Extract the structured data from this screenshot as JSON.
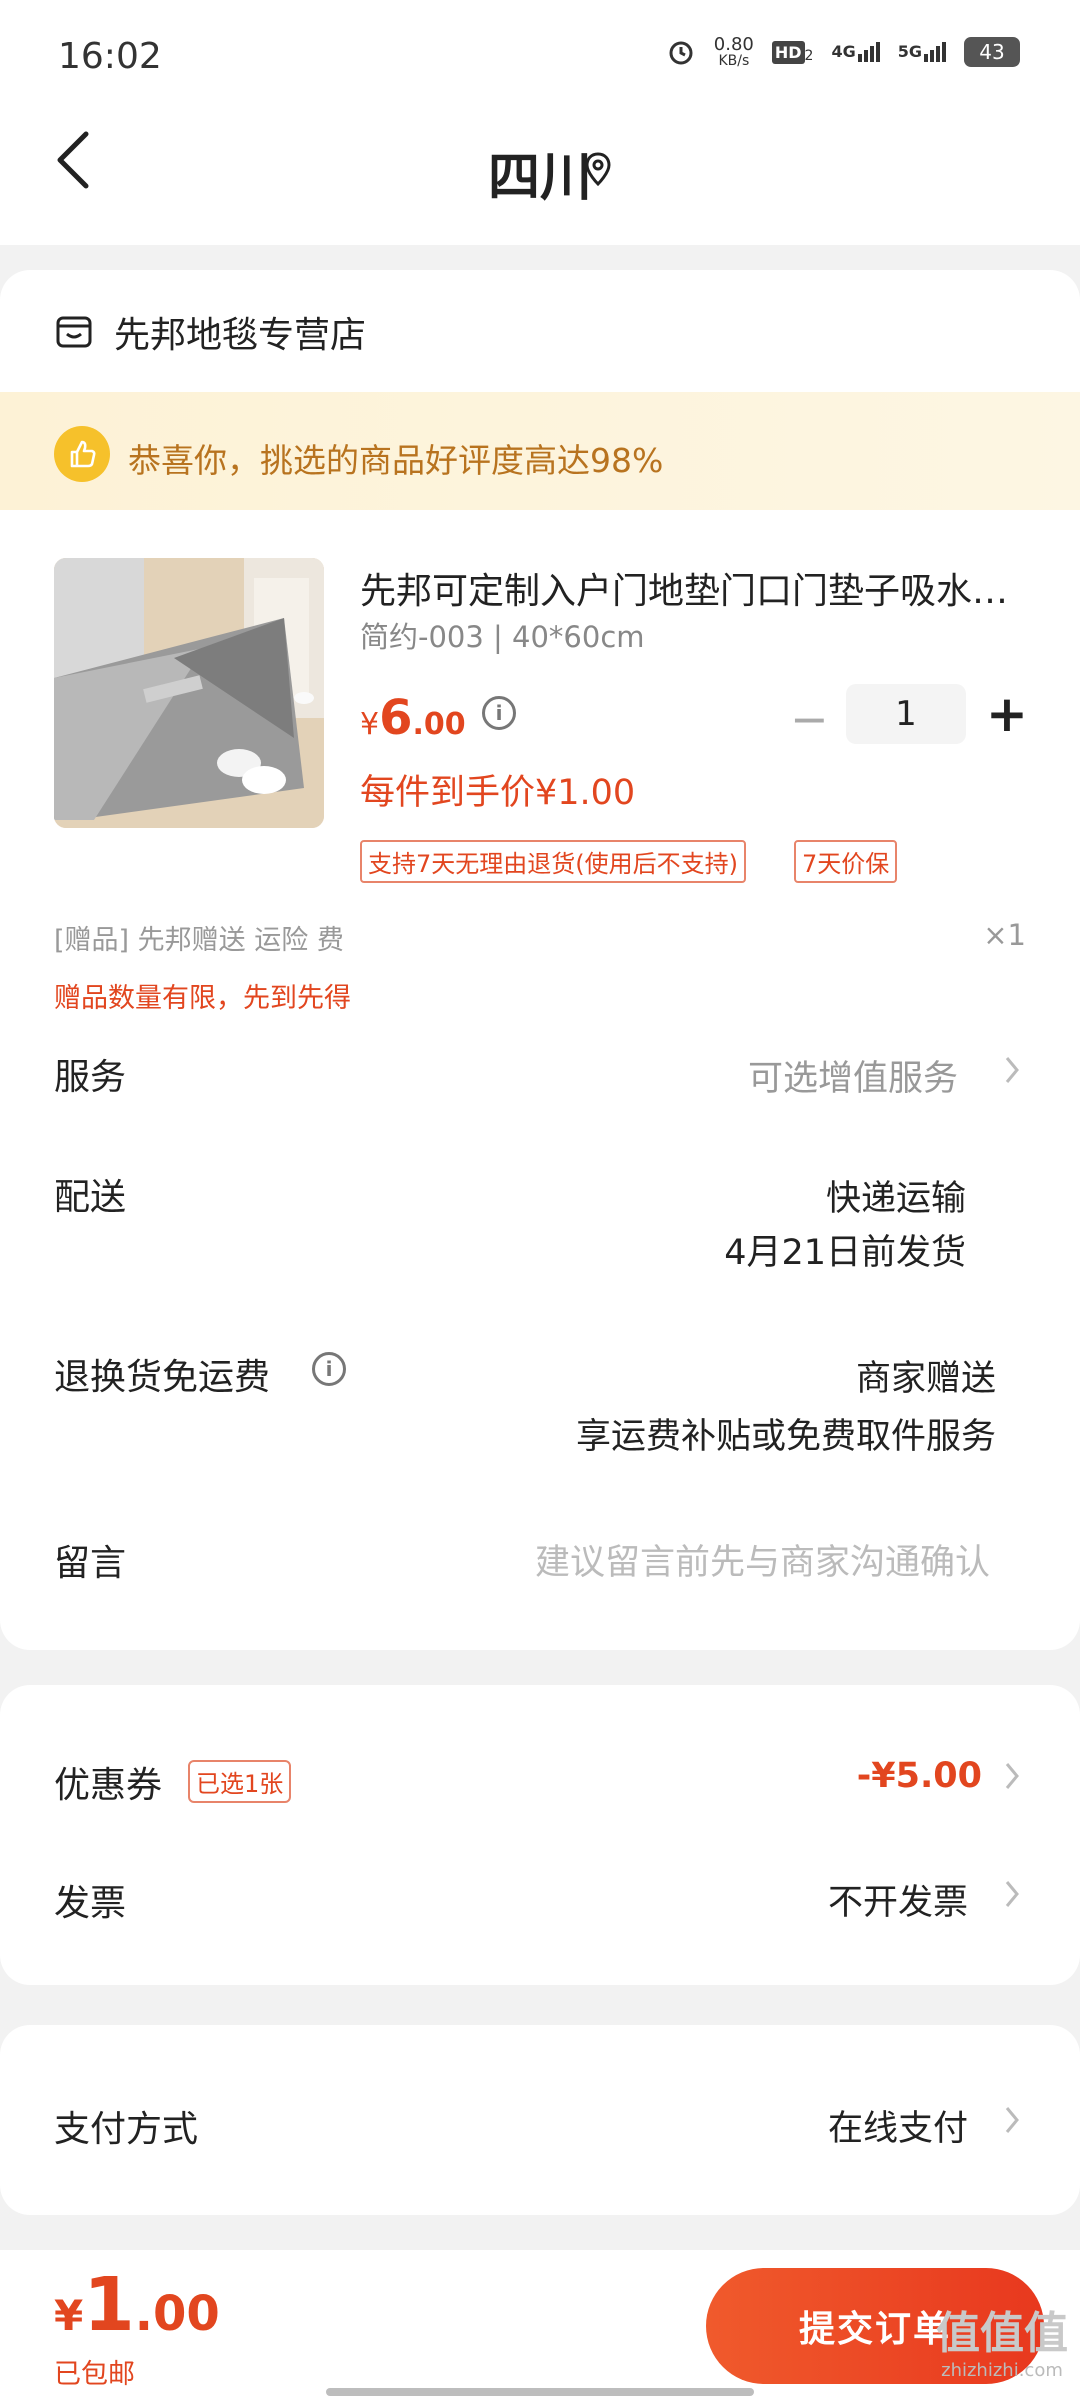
{
  "status_bar": {
    "time": "16:02",
    "net_speed_value": "0.80",
    "net_speed_unit": "KB/s",
    "hd_label": "HD",
    "hd_sub": "2",
    "sig1_label": "4G",
    "sig2_label": "5G",
    "battery": "43"
  },
  "header": {
    "title": "四川"
  },
  "store": {
    "name": "先邦地毯专营店"
  },
  "banner": {
    "text": "恭喜你，挑选的商品好评度高达98%"
  },
  "product": {
    "title": "先邦可定制入户门地垫门口门垫子吸水地毯",
    "spec": "简约-003 | 40*60cm",
    "price_currency": "¥",
    "price_int": "6",
    "price_dec": ".00",
    "quantity": "1",
    "minus_symbol": "−",
    "plus_symbol": "+",
    "unit_price_text": "每件到手价¥1.00",
    "tags": [
      "支持7天无理由退货(使用后不支持)",
      "7天价保"
    ]
  },
  "gift": {
    "label": "[赠品]   先邦赠送 运险 费",
    "qty": "×1",
    "note": "赠品数量有限，先到先得"
  },
  "rows": {
    "service_label": "服务",
    "service_value": "可选增值服务",
    "delivery_label": "配送",
    "delivery_value1": "快递运输",
    "delivery_value2": "4月21日前发货",
    "return_label": "退换货免运费",
    "return_value1": "商家赠送",
    "return_value2": "享运费补贴或免费取件服务",
    "message_label": "留言",
    "message_placeholder": "建议留言前先与商家沟通确认"
  },
  "coupon": {
    "label": "优惠券",
    "tag": "已选1张",
    "value": "-¥5.00"
  },
  "invoice": {
    "label": "发票",
    "value": "不开发票"
  },
  "payment": {
    "label": "支付方式",
    "value": "在线支付"
  },
  "footer": {
    "total_currency": "¥",
    "total_int": "1",
    "total_dec": ".00",
    "shipping": "已包邮",
    "submit": "提交订单",
    "watermark": "值值值",
    "watermark_url": "zhizhizhi.com"
  },
  "colors": {
    "accent": "#e2461f",
    "banner_text": "#b8731f",
    "banner_bg": "#fdf2d6"
  }
}
